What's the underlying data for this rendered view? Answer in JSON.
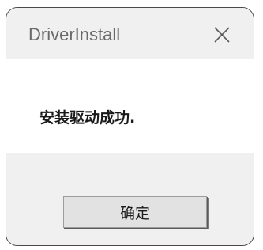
{
  "window": {
    "title": "DriverInstall",
    "close_icon": "close-icon"
  },
  "content": {
    "message": "安装驱动成功."
  },
  "footer": {
    "ok_label": "确定"
  }
}
